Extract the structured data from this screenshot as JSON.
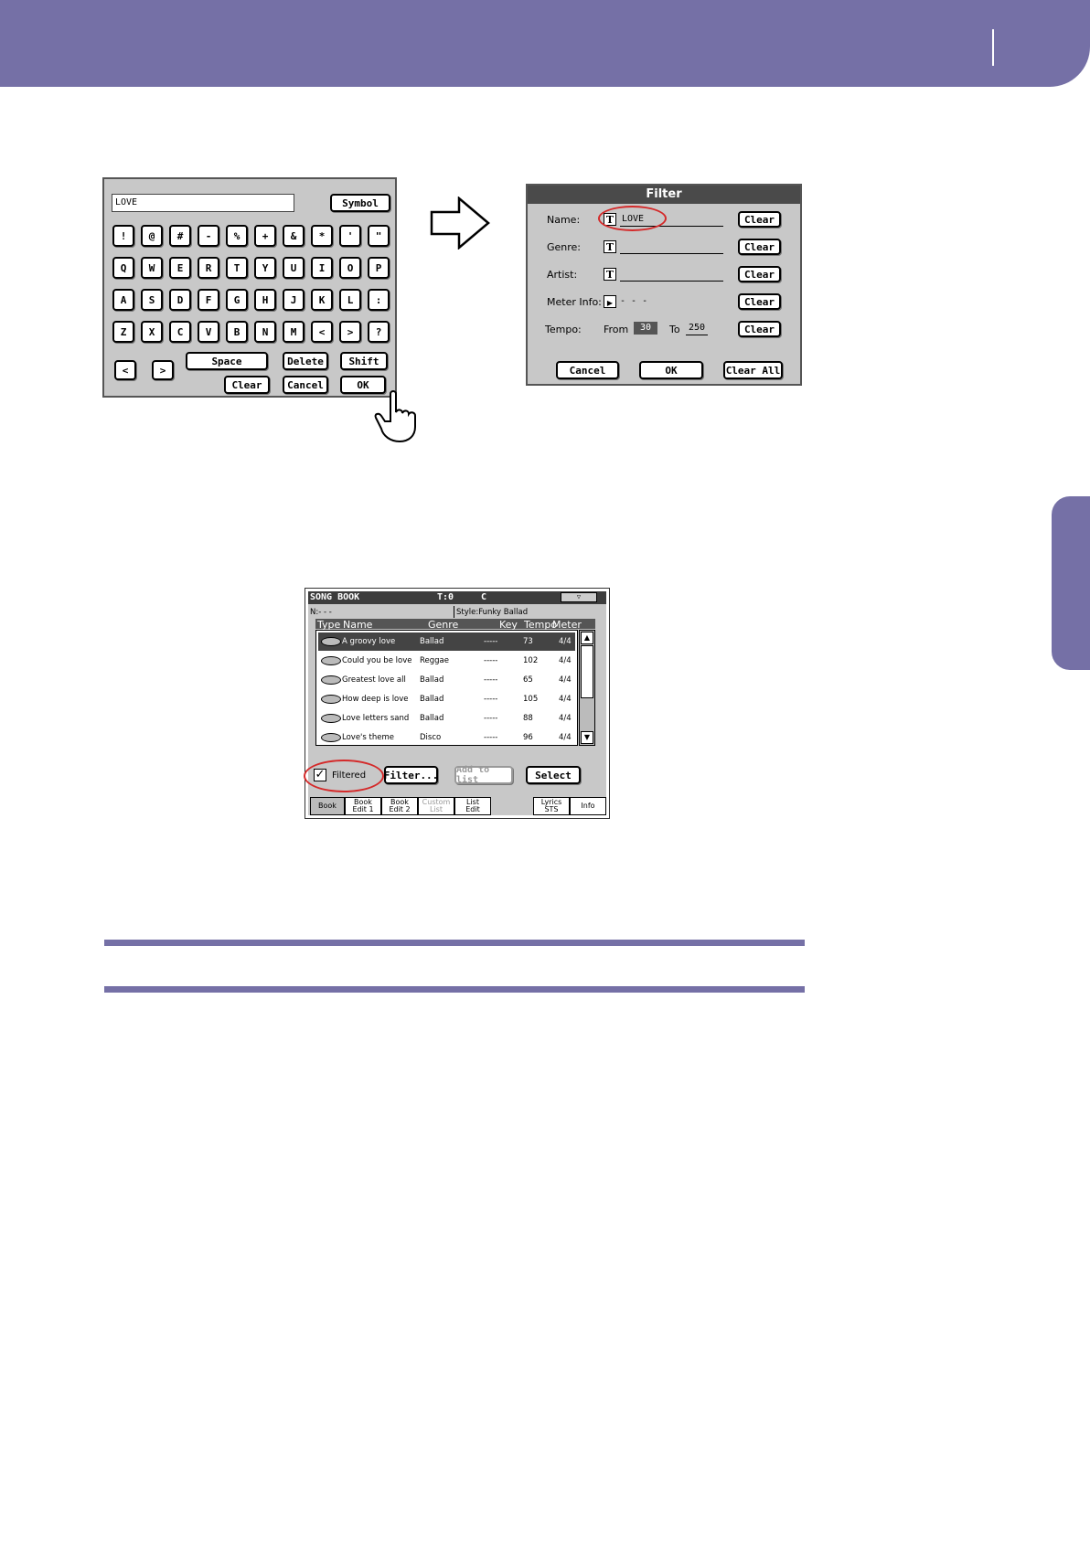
{
  "keyboard": {
    "input_value": "LOVE",
    "symbol_label": "Symbol",
    "rows": [
      [
        "!",
        "@",
        "#",
        "-",
        "%",
        "+",
        "&",
        "*",
        "'",
        "\""
      ],
      [
        "Q",
        "W",
        "E",
        "R",
        "T",
        "Y",
        "U",
        "I",
        "O",
        "P"
      ],
      [
        "A",
        "S",
        "D",
        "F",
        "G",
        "H",
        "J",
        "K",
        "L",
        ":"
      ],
      [
        "Z",
        "X",
        "C",
        "V",
        "B",
        "N",
        "M",
        "<",
        ">",
        "?"
      ]
    ],
    "left_arrow": "<",
    "right_arrow": ">",
    "space_label": "Space",
    "delete_label": "Delete",
    "shift_label": "Shift",
    "clear_label": "Clear",
    "cancel_label": "Cancel",
    "ok_label": "OK"
  },
  "filter": {
    "title": "Filter",
    "name_label": "Name:",
    "name_value": "LOVE",
    "genre_label": "Genre:",
    "artist_label": "Artist:",
    "meter_label": "Meter Info:",
    "meter_value": "- - -",
    "tempo_label": "Tempo:",
    "from_label": "From",
    "from_value": "30",
    "to_label": "To",
    "to_value": "250",
    "clear_label": "Clear",
    "cancel_label": "Cancel",
    "ok_label": "OK",
    "clear_all_label": "Clear All"
  },
  "songbook": {
    "title": "SONG BOOK",
    "transpose": "T:0",
    "key": "C",
    "info_left": "N:- - -",
    "info_right": "Style:Funky Ballad",
    "columns": [
      "Type",
      "Name",
      "Genre",
      "Key",
      "Tempo",
      "Meter"
    ],
    "rows": [
      {
        "name": "A groovy love",
        "genre": "Ballad",
        "key": "-----",
        "tempo": "73",
        "meter": "4/4"
      },
      {
        "name": "Could you be love",
        "genre": "Reggae",
        "key": "-----",
        "tempo": "102",
        "meter": "4/4"
      },
      {
        "name": "Greatest love all",
        "genre": "Ballad",
        "key": "-----",
        "tempo": "65",
        "meter": "4/4"
      },
      {
        "name": "How deep is love",
        "genre": "Ballad",
        "key": "-----",
        "tempo": "105",
        "meter": "4/4"
      },
      {
        "name": "Love letters sand",
        "genre": "Ballad",
        "key": "-----",
        "tempo": "88",
        "meter": "4/4"
      },
      {
        "name": "Love's theme",
        "genre": "Disco",
        "key": "-----",
        "tempo": "96",
        "meter": "4/4"
      }
    ],
    "filtered_label": "Filtered",
    "filter_button": "Filter...",
    "add_to_list": "Add to list",
    "select_label": "Select",
    "tabs": [
      {
        "l1": "Book",
        "l2": ""
      },
      {
        "l1": "Book",
        "l2": "Edit 1"
      },
      {
        "l1": "Book",
        "l2": "Edit 2"
      },
      {
        "l1": "Custom",
        "l2": "List"
      },
      {
        "l1": "List",
        "l2": "Edit"
      },
      {
        "l1": "Lyrics",
        "l2": "STS"
      },
      {
        "l1": "Info",
        "l2": ""
      }
    ]
  },
  "colors": {
    "accent": "#7570a6",
    "highlight_ring": "#d42a2a"
  }
}
